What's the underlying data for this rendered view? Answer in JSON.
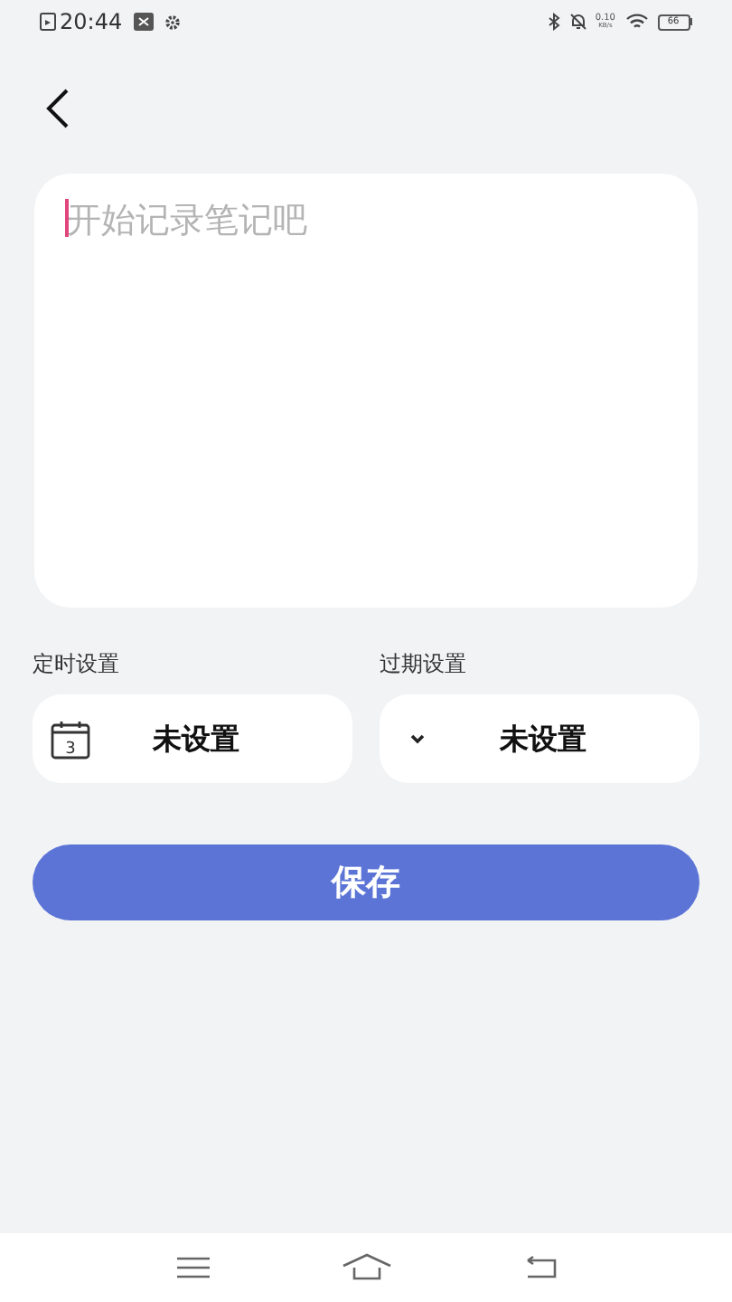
{
  "status_bar": {
    "time": "20:44",
    "net_speed": "0.10",
    "net_unit": "KB/s",
    "battery": "66"
  },
  "note": {
    "placeholder": "开始记录笔记吧"
  },
  "settings": [
    {
      "kind": "timer",
      "label": "定时设置",
      "value": "未设置",
      "calendar_day": "3"
    },
    {
      "kind": "expiry",
      "label": "过期设置",
      "value": "未设置"
    }
  ],
  "save_button": "保存"
}
